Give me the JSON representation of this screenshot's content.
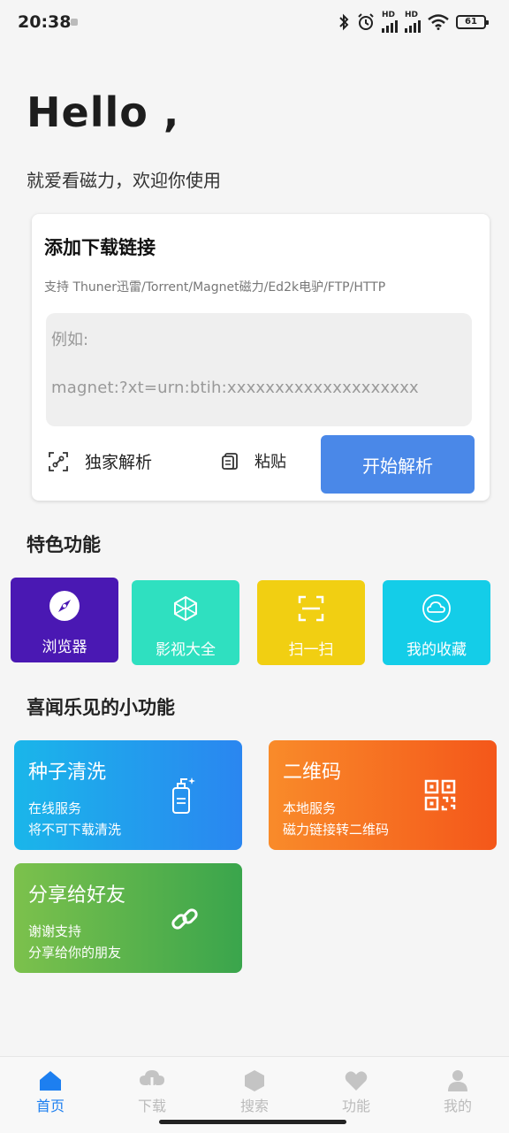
{
  "status_bar": {
    "time": "20:38",
    "battery": "61",
    "hd1": "HD",
    "hd2": "HD"
  },
  "greeting": {
    "title": "Hello ,",
    "subtitle": "就爱看磁力，欢迎你使用"
  },
  "download_card": {
    "title": "添加下载链接",
    "description": "支持 Thuner迅雷/Torrent/Magnet磁力/Ed2k电驴/FTP/HTTP",
    "placeholder_line1": "例如:",
    "placeholder_line2": "magnet:?xt=urn:btih:xxxxxxxxxxxxxxxxxxxx",
    "exclusive_label": "独家解析",
    "paste_label": "粘贴",
    "start_label": "开始解析"
  },
  "features": {
    "title": "特色功能",
    "items": [
      {
        "label": "浏览器",
        "icon": "compass-icon",
        "color": "#4a18b3"
      },
      {
        "label": "影视大全",
        "icon": "cube-icon",
        "color": "#2fe0c0"
      },
      {
        "label": "扫一扫",
        "icon": "scan-icon",
        "color": "#f1cf12"
      },
      {
        "label": "我的收藏",
        "icon": "cloud-icon",
        "color": "#14cde8"
      }
    ]
  },
  "tools": {
    "title": "喜闻乐见的小功能",
    "items": [
      {
        "title": "种子清洗",
        "line1": "在线服务",
        "line2": "将不可下载清洗",
        "icon": "sanitizer-bottle-icon"
      },
      {
        "title": "二维码",
        "line1": "本地服务",
        "line2": "磁力链接转二维码",
        "icon": "qr-code-icon"
      },
      {
        "title": "分享给好友",
        "line1": "谢谢支持",
        "line2": "分享给你的朋友",
        "icon": "link-icon"
      }
    ]
  },
  "bottom_nav": {
    "items": [
      {
        "label": "首页",
        "icon": "home-icon",
        "active": true
      },
      {
        "label": "下载",
        "icon": "download-cloud-icon"
      },
      {
        "label": "搜索",
        "icon": "hexagon-icon"
      },
      {
        "label": "功能",
        "icon": "heart-icon"
      },
      {
        "label": "我的",
        "icon": "user-icon"
      }
    ]
  },
  "colors": {
    "accent": "#4a88e8",
    "nav_active": "#1d7ff0"
  }
}
